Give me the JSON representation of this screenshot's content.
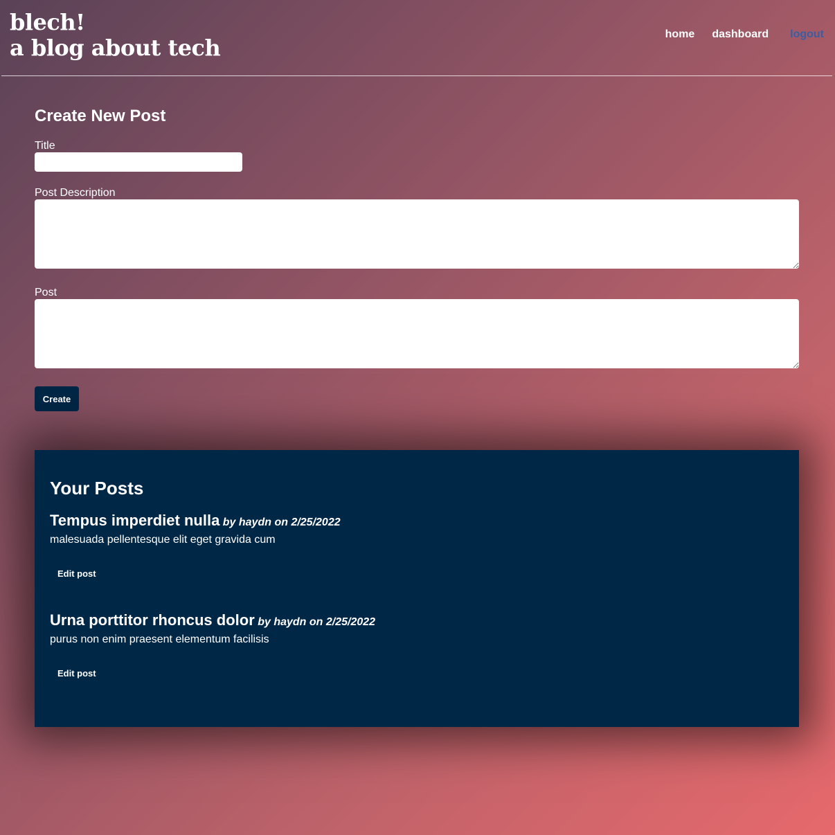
{
  "header": {
    "brand_line1": "blech!",
    "brand_line2": "a blog about tech",
    "nav": {
      "home": "home",
      "dashboard": "dashboard",
      "logout": "logout"
    }
  },
  "create_form": {
    "heading": "Create New Post",
    "title_label": "Title",
    "title_value": "",
    "description_label": "Post Description",
    "description_value": "",
    "post_label": "Post",
    "post_value": "",
    "submit_label": "Create"
  },
  "your_posts": {
    "heading": "Your Posts",
    "posts": [
      {
        "title": "Tempus imperdiet nulla",
        "meta": "by haydn on 2/25/2022",
        "description": "malesuada pellentesque elit eget gravida cum",
        "edit_label": "Edit post"
      },
      {
        "title": "Urna porttitor rhoncus dolor",
        "meta": "by haydn on 2/25/2022",
        "description": "purus non enim praesent elementum facilisis",
        "edit_label": "Edit post"
      }
    ]
  },
  "colors": {
    "gradient_start": "#5a4257",
    "gradient_end": "#e6696c",
    "panel": "#002746",
    "button": "#002746",
    "logout_link": "#3a5ea1"
  }
}
